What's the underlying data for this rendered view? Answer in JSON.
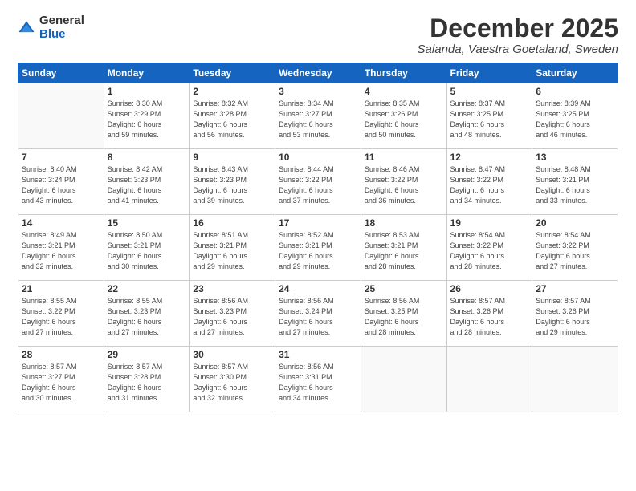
{
  "logo": {
    "general": "General",
    "blue": "Blue"
  },
  "header": {
    "month": "December 2025",
    "location": "Salanda, Vaestra Goetaland, Sweden"
  },
  "weekdays": [
    "Sunday",
    "Monday",
    "Tuesday",
    "Wednesday",
    "Thursday",
    "Friday",
    "Saturday"
  ],
  "weeks": [
    [
      {
        "day": "",
        "info": ""
      },
      {
        "day": "1",
        "info": "Sunrise: 8:30 AM\nSunset: 3:29 PM\nDaylight: 6 hours\nand 59 minutes."
      },
      {
        "day": "2",
        "info": "Sunrise: 8:32 AM\nSunset: 3:28 PM\nDaylight: 6 hours\nand 56 minutes."
      },
      {
        "day": "3",
        "info": "Sunrise: 8:34 AM\nSunset: 3:27 PM\nDaylight: 6 hours\nand 53 minutes."
      },
      {
        "day": "4",
        "info": "Sunrise: 8:35 AM\nSunset: 3:26 PM\nDaylight: 6 hours\nand 50 minutes."
      },
      {
        "day": "5",
        "info": "Sunrise: 8:37 AM\nSunset: 3:25 PM\nDaylight: 6 hours\nand 48 minutes."
      },
      {
        "day": "6",
        "info": "Sunrise: 8:39 AM\nSunset: 3:25 PM\nDaylight: 6 hours\nand 46 minutes."
      }
    ],
    [
      {
        "day": "7",
        "info": "Sunrise: 8:40 AM\nSunset: 3:24 PM\nDaylight: 6 hours\nand 43 minutes."
      },
      {
        "day": "8",
        "info": "Sunrise: 8:42 AM\nSunset: 3:23 PM\nDaylight: 6 hours\nand 41 minutes."
      },
      {
        "day": "9",
        "info": "Sunrise: 8:43 AM\nSunset: 3:23 PM\nDaylight: 6 hours\nand 39 minutes."
      },
      {
        "day": "10",
        "info": "Sunrise: 8:44 AM\nSunset: 3:22 PM\nDaylight: 6 hours\nand 37 minutes."
      },
      {
        "day": "11",
        "info": "Sunrise: 8:46 AM\nSunset: 3:22 PM\nDaylight: 6 hours\nand 36 minutes."
      },
      {
        "day": "12",
        "info": "Sunrise: 8:47 AM\nSunset: 3:22 PM\nDaylight: 6 hours\nand 34 minutes."
      },
      {
        "day": "13",
        "info": "Sunrise: 8:48 AM\nSunset: 3:21 PM\nDaylight: 6 hours\nand 33 minutes."
      }
    ],
    [
      {
        "day": "14",
        "info": "Sunrise: 8:49 AM\nSunset: 3:21 PM\nDaylight: 6 hours\nand 32 minutes."
      },
      {
        "day": "15",
        "info": "Sunrise: 8:50 AM\nSunset: 3:21 PM\nDaylight: 6 hours\nand 30 minutes."
      },
      {
        "day": "16",
        "info": "Sunrise: 8:51 AM\nSunset: 3:21 PM\nDaylight: 6 hours\nand 29 minutes."
      },
      {
        "day": "17",
        "info": "Sunrise: 8:52 AM\nSunset: 3:21 PM\nDaylight: 6 hours\nand 29 minutes."
      },
      {
        "day": "18",
        "info": "Sunrise: 8:53 AM\nSunset: 3:21 PM\nDaylight: 6 hours\nand 28 minutes."
      },
      {
        "day": "19",
        "info": "Sunrise: 8:54 AM\nSunset: 3:22 PM\nDaylight: 6 hours\nand 28 minutes."
      },
      {
        "day": "20",
        "info": "Sunrise: 8:54 AM\nSunset: 3:22 PM\nDaylight: 6 hours\nand 27 minutes."
      }
    ],
    [
      {
        "day": "21",
        "info": "Sunrise: 8:55 AM\nSunset: 3:22 PM\nDaylight: 6 hours\nand 27 minutes."
      },
      {
        "day": "22",
        "info": "Sunrise: 8:55 AM\nSunset: 3:23 PM\nDaylight: 6 hours\nand 27 minutes."
      },
      {
        "day": "23",
        "info": "Sunrise: 8:56 AM\nSunset: 3:23 PM\nDaylight: 6 hours\nand 27 minutes."
      },
      {
        "day": "24",
        "info": "Sunrise: 8:56 AM\nSunset: 3:24 PM\nDaylight: 6 hours\nand 27 minutes."
      },
      {
        "day": "25",
        "info": "Sunrise: 8:56 AM\nSunset: 3:25 PM\nDaylight: 6 hours\nand 28 minutes."
      },
      {
        "day": "26",
        "info": "Sunrise: 8:57 AM\nSunset: 3:26 PM\nDaylight: 6 hours\nand 28 minutes."
      },
      {
        "day": "27",
        "info": "Sunrise: 8:57 AM\nSunset: 3:26 PM\nDaylight: 6 hours\nand 29 minutes."
      }
    ],
    [
      {
        "day": "28",
        "info": "Sunrise: 8:57 AM\nSunset: 3:27 PM\nDaylight: 6 hours\nand 30 minutes."
      },
      {
        "day": "29",
        "info": "Sunrise: 8:57 AM\nSunset: 3:28 PM\nDaylight: 6 hours\nand 31 minutes."
      },
      {
        "day": "30",
        "info": "Sunrise: 8:57 AM\nSunset: 3:30 PM\nDaylight: 6 hours\nand 32 minutes."
      },
      {
        "day": "31",
        "info": "Sunrise: 8:56 AM\nSunset: 3:31 PM\nDaylight: 6 hours\nand 34 minutes."
      },
      {
        "day": "",
        "info": ""
      },
      {
        "day": "",
        "info": ""
      },
      {
        "day": "",
        "info": ""
      }
    ]
  ]
}
